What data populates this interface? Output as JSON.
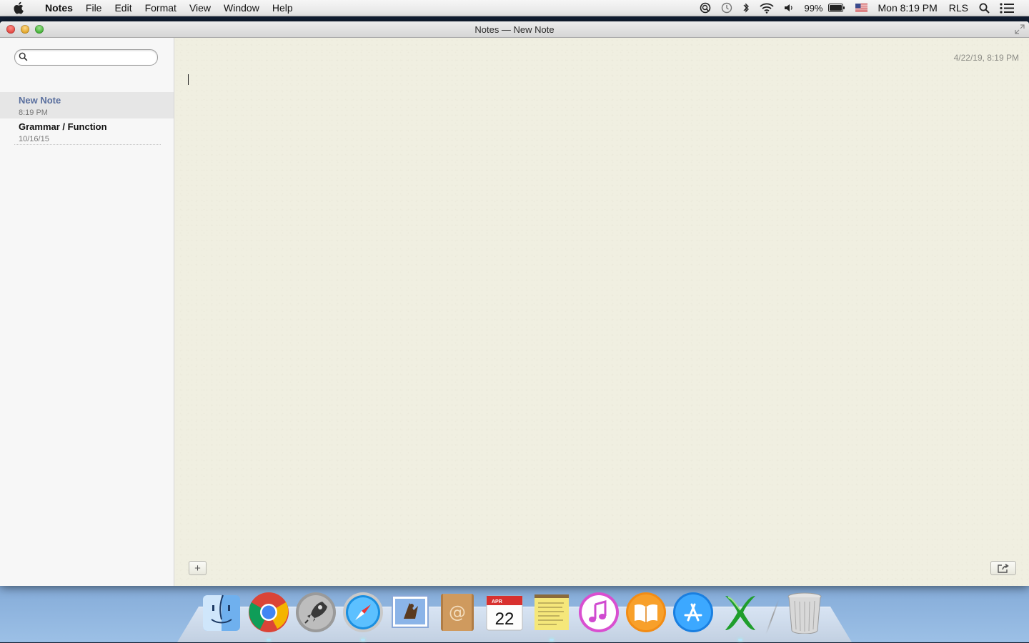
{
  "menubar": {
    "app_name": "Notes",
    "items": [
      "File",
      "Edit",
      "Format",
      "View",
      "Window",
      "Help"
    ],
    "battery": "99%",
    "clock": "Mon 8:19 PM",
    "user": "RLS",
    "status_icons": [
      "spotlight-magnifier-icon",
      "time-machine-icon",
      "bluetooth-icon",
      "wifi-icon",
      "volume-icon",
      "battery-icon",
      "us-flag-input-icon",
      "search-icon",
      "notification-center-icon"
    ]
  },
  "window": {
    "title": "Notes — New Note"
  },
  "sidebar": {
    "search_placeholder": "",
    "notes": [
      {
        "title": "New Note",
        "date": "8:19 PM",
        "selected": true
      },
      {
        "title": "Grammar / Function",
        "date": "10/16/15",
        "selected": false
      }
    ]
  },
  "editor": {
    "timestamp": "4/22/19, 8:19 PM",
    "body": "",
    "add_label": "+"
  },
  "dock": {
    "items": [
      "Finder",
      "Google Chrome",
      "Launchpad",
      "Safari",
      "Mail",
      "Contacts",
      "Calendar",
      "Notes",
      "iTunes",
      "iBooks",
      "App Store",
      "Microsoft Excel",
      "Trash"
    ],
    "calendar_month": "APR",
    "calendar_day": "22"
  },
  "colors": {
    "selected_note_title": "#5a6f9e",
    "editor_paper": "#f0efe1"
  }
}
